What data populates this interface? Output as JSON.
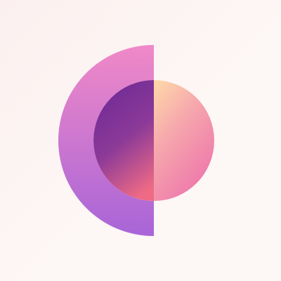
{
  "logo": {
    "name": "crescent-orb-logo",
    "colors": {
      "background": "#fbf3f1",
      "outer_arc_top": "#f089c7",
      "outer_arc_bottom": "#a865d8",
      "inner_left_top": "#6f2a95",
      "inner_left_bottom": "#ef6b85",
      "inner_right_top": "#fedaa8",
      "inner_right_bottom": "#ee78ab"
    }
  }
}
